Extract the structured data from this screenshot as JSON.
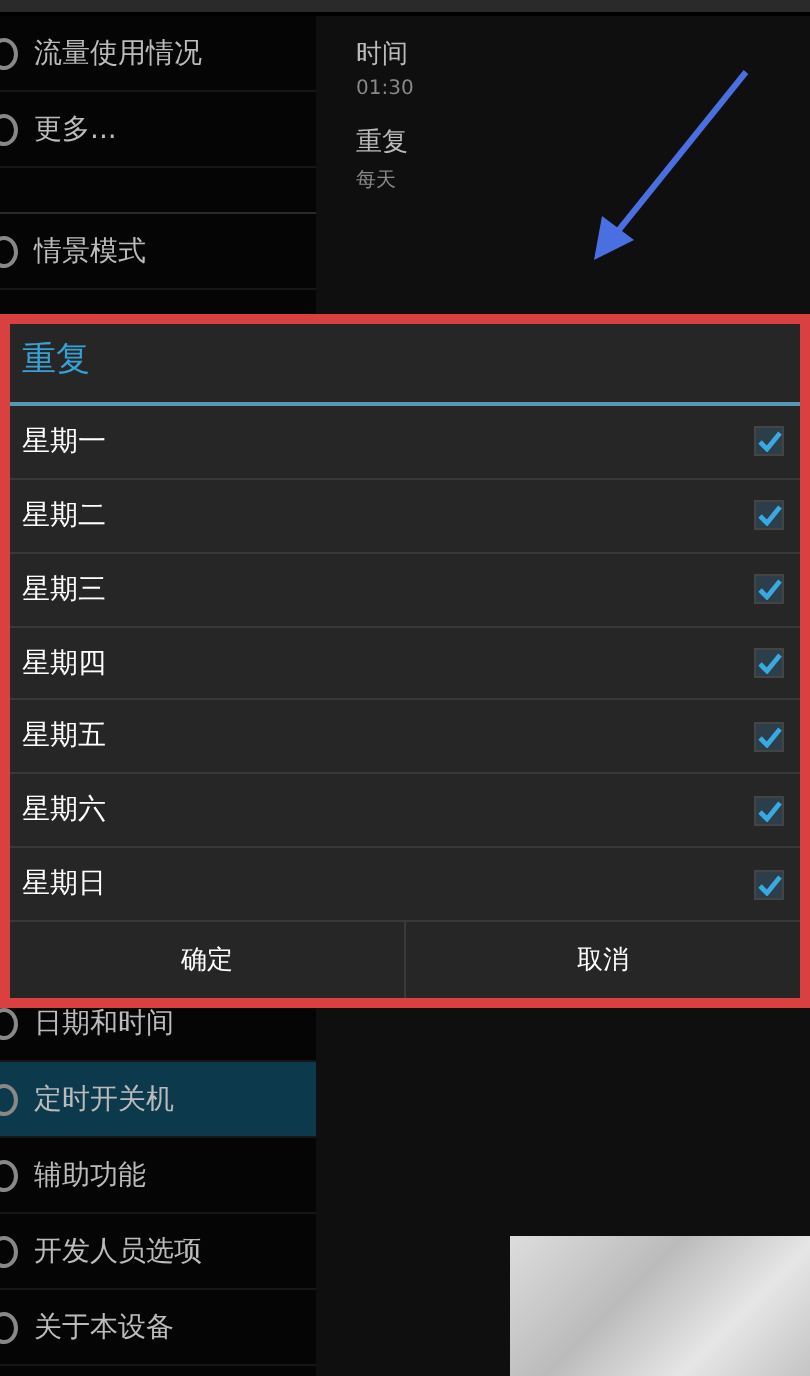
{
  "sidebar": {
    "top_items": [
      {
        "label": "流量使用情况",
        "selected": false
      },
      {
        "label": "更多...",
        "selected": false
      },
      {
        "label": "情景模式",
        "selected": false
      }
    ],
    "bottom_items": [
      {
        "label": "日期和时间",
        "selected": false
      },
      {
        "label": "定时开关机",
        "selected": true
      },
      {
        "label": "辅助功能",
        "selected": false
      },
      {
        "label": "开发人员选项",
        "selected": false
      },
      {
        "label": "关于本设备",
        "selected": false
      }
    ]
  },
  "detail": [
    {
      "title": "时间",
      "value": "01:30"
    },
    {
      "title": "重复",
      "value": "每天"
    }
  ],
  "dialog": {
    "title": "重复",
    "days": [
      {
        "label": "星期一",
        "checked": true
      },
      {
        "label": "星期二",
        "checked": true
      },
      {
        "label": "星期三",
        "checked": true
      },
      {
        "label": "星期四",
        "checked": true
      },
      {
        "label": "星期五",
        "checked": true
      },
      {
        "label": "星期六",
        "checked": true
      },
      {
        "label": "星期日",
        "checked": true
      }
    ],
    "buttons": [
      "确定",
      "取消"
    ]
  }
}
